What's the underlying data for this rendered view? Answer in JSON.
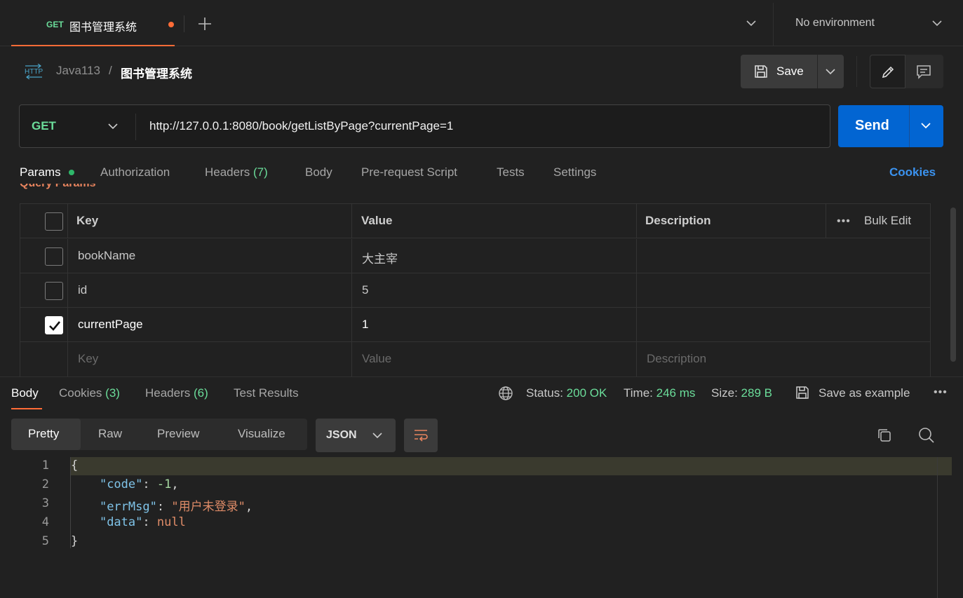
{
  "tab": {
    "method": "GET",
    "title": "图书管理系统"
  },
  "environment": {
    "label": "No environment"
  },
  "breadcrumb": {
    "icon": "http-icon",
    "parent": "Java113",
    "separator": "/",
    "current": "图书管理系统"
  },
  "toolbar": {
    "save_label": "Save"
  },
  "request": {
    "method": "GET",
    "url": "http://127.0.0.1:8080/book/getListByPage?currentPage=1",
    "send_label": "Send"
  },
  "request_tabs": {
    "params": "Params",
    "authorization": "Authorization",
    "headers": "Headers",
    "headers_count": "(7)",
    "body": "Body",
    "prerequest": "Pre-request Script",
    "tests": "Tests",
    "settings": "Settings",
    "cookies": "Cookies"
  },
  "params_section": {
    "title": "Query Params"
  },
  "params_table": {
    "headers": {
      "key": "Key",
      "value": "Value",
      "description": "Description",
      "bulk_edit": "Bulk Edit",
      "more": "•••"
    },
    "rows": [
      {
        "checked": false,
        "key": "bookName",
        "value": "大主宰",
        "description": ""
      },
      {
        "checked": false,
        "key": "id",
        "value": "5",
        "description": ""
      },
      {
        "checked": true,
        "key": "currentPage",
        "value": "1",
        "description": ""
      }
    ],
    "placeholder": {
      "key": "Key",
      "value": "Value",
      "description": "Description"
    }
  },
  "response_tabs": {
    "body": "Body",
    "cookies": "Cookies",
    "cookies_count": "(3)",
    "headers": "Headers",
    "headers_count": "(6)",
    "test_results": "Test Results"
  },
  "response_status": {
    "status_label": "Status:",
    "status_value": "200 OK",
    "time_label": "Time:",
    "time_value": "246 ms",
    "size_label": "Size:",
    "size_value": "289 B",
    "save_example": "Save as example",
    "more": "•••"
  },
  "view_modes": [
    "Pretty",
    "Raw",
    "Preview",
    "Visualize"
  ],
  "format": {
    "label": "JSON"
  },
  "code": {
    "line_numbers": [
      "1",
      "2",
      "3",
      "4",
      "5"
    ],
    "open_brace": "{",
    "close_brace": "}",
    "entries": [
      {
        "key": "\"code\"",
        "value": "-1",
        "type": "number",
        "comma": ","
      },
      {
        "key": "\"errMsg\"",
        "value": "\"用户未登录\"",
        "type": "string",
        "comma": ","
      },
      {
        "key": "\"data\"",
        "value": "null",
        "type": "null",
        "comma": ""
      }
    ]
  },
  "colors": {
    "accent": "#ff6c37",
    "method_get": "#6bdd9a",
    "send_button": "#0265d2",
    "link": "#3b93f0",
    "background": "#212121"
  }
}
